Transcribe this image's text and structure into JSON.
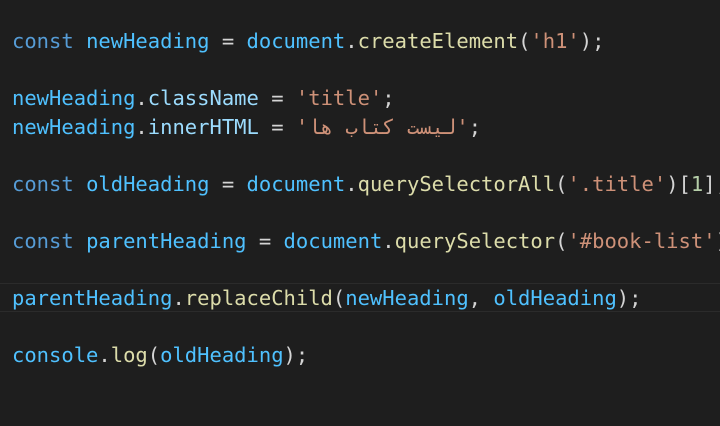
{
  "editor": {
    "colors": {
      "background": "#1e1e1e",
      "keyword": "#569cd6",
      "variable": "#4fc1ff",
      "property": "#9cdcfe",
      "function": "#dcdcaa",
      "string": "#ce9178",
      "number": "#b5cea8",
      "punctuation": "#d4d4d4"
    },
    "line1": {
      "kw": "const",
      "var": "newHeading",
      "eq": "=",
      "obj": "document",
      "dot": ".",
      "fn": "createElement",
      "open": "(",
      "str": "'h1'",
      "close": ");"
    },
    "line3": {
      "var": "newHeading",
      "dot": ".",
      "prop": "className",
      "eq": "=",
      "str": "'title'",
      "end": ";"
    },
    "line4": {
      "var": "newHeading",
      "dot": ".",
      "prop": "innerHTML",
      "eq": "=",
      "quote_open": "'",
      "str_rtl": "لیست کتاب ها",
      "quote_close": "'",
      "end": ";"
    },
    "line6": {
      "kw": "const",
      "var": "oldHeading",
      "eq": "=",
      "obj": "document",
      "dot": ".",
      "fn": "querySelectorAll",
      "open": "(",
      "str": "'.title'",
      "close": ")[",
      "num": "1",
      "end": "];"
    },
    "line8": {
      "kw": "const",
      "var": "parentHeading",
      "eq": "=",
      "obj": "document",
      "dot": ".",
      "fn": "querySelector",
      "open": "(",
      "str": "'#book-list'",
      "close": ");"
    },
    "line10": {
      "var": "parentHeading",
      "dot": ".",
      "fn": "replaceChild",
      "open": "(",
      "arg1": "newHeading",
      "comma": ", ",
      "arg2": "oldHeading",
      "close": ");"
    },
    "line12": {
      "obj": "console",
      "dot": ".",
      "fn": "log",
      "open": "(",
      "arg": "oldHeading",
      "close": ");"
    }
  }
}
